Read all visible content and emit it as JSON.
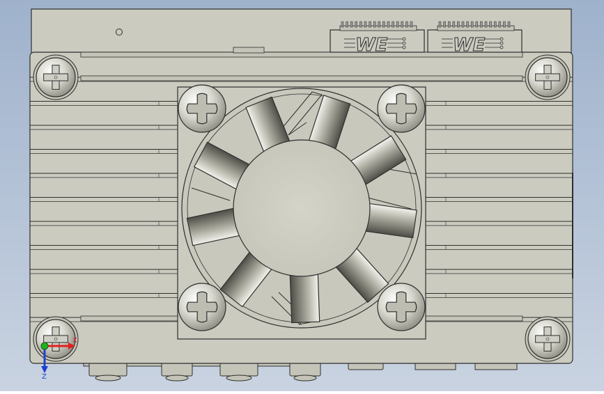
{
  "viewport": {
    "background_top": "#9fb2cc",
    "background_bottom": "#c9d3e1"
  },
  "model": {
    "body_color": "#cbcbc0",
    "edge_color": "#2e2e2e",
    "blade_count": 9,
    "connector_count": 2,
    "connector_logo_text": "WE",
    "fin_count": 11
  },
  "triad": {
    "x_axis_color": "#e02020",
    "y_axis_color": "#20b020",
    "z_axis_color": "#2040d0",
    "x_label": "X",
    "z_label": "Z"
  }
}
